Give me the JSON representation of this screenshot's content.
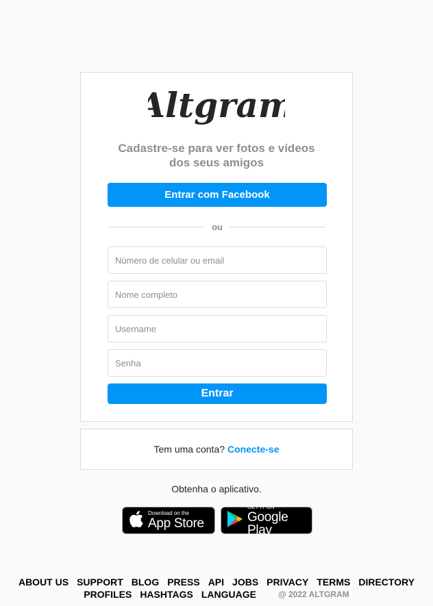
{
  "brand": {
    "name": "Altgram"
  },
  "signup": {
    "tagline": "Cadastre-se para ver fotos e vídeos dos seus amigos",
    "facebook_button": "Entrar com Facebook",
    "divider_text": "ou",
    "fields": {
      "contact_placeholder": "Número de celular ou email",
      "fullname_placeholder": "Nome completo",
      "username_placeholder": "Username",
      "password_placeholder": "Senha"
    },
    "submit_button": "Entrar"
  },
  "login_prompt": {
    "text": "Tem uma conta?",
    "link": "Conecte-se"
  },
  "get_app": {
    "text": "Obtenha o aplicativo.",
    "app_store": {
      "small": "Download on the",
      "big": "App Store"
    },
    "google_play": {
      "small": "GET IT ON",
      "big": "Google Play"
    }
  },
  "footer": {
    "links": [
      "ABOUT US",
      "SUPPORT",
      "BLOG",
      "PRESS",
      "API",
      "JOBS",
      "PRIVACY",
      "TERMS",
      "DIRECTORY",
      "PROFILES",
      "HASHTAGS",
      "LANGUAGE"
    ],
    "copyright": "@ 2022 ALTGRAM"
  },
  "colors": {
    "accent": "#0095f6",
    "border": "#dbdbdb",
    "muted": "#8e8e8e",
    "background": "#fafafa"
  }
}
